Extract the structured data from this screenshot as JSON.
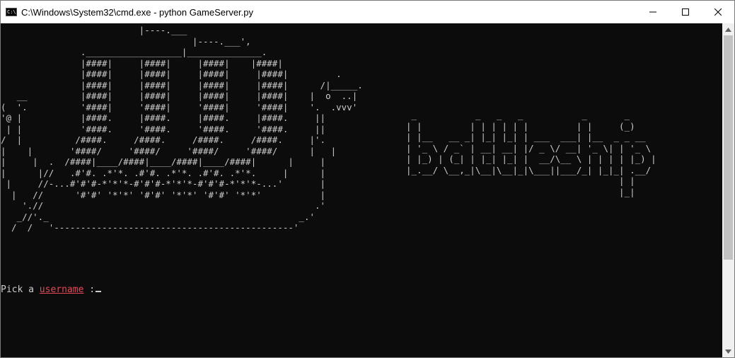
{
  "window": {
    "title": "C:\\Windows\\System32\\cmd.exe - python  GameServer.py",
    "icon": "cmd-icon"
  },
  "controls": {
    "minimize": "minimize-icon",
    "maximize": "maximize-icon",
    "close": "close-icon"
  },
  "terminal": {
    "ship_art": "                          |----.___\n                                    |----.___',\n               .__________________|______________.\n               |####|     |####|     |####|    |####|\n               |####|     |####|     |####|     |####|         .\n               |####|     |####|     |####|     |####|      /|_____.\n   __          |####|     |####|     |####|     |####|    |  o  ..|\n(  '.          '####|     '####|     '####|     '####|    '.  .vvv'\n'@ |           |####.     |####.     |####.     |####.     ||\n | |           '####.     '####.     '####.     '####.     ||\n/  |          /####.     /####.     /####.     /####.     |'.\n|    |       '####/     '####/     '####/     '####/      |   |\n|     |  .  /####|____/####|____/####|____/####|      |     |\n|      |//   .#'#. .*'*. .#'#. .*'*. .#'#. .*'*.     |      |\n |     //-...#'#'#-*'*'*-#'#'#-*'*'*-#'#'#-*'*'*-...'       |\n  |   //      '#'#' '*'*' '#'#' '*'*' '#'#' '*'*'           |\n    './/                                                   .'\n   _//'._                                               _.'\n  /  /   '---------------------------------------------'",
    "logo_art": " _           _   _   _           _       _\n| |         | | | | | |         | |     (_)\n| |__   __ _| |_| |_| | ___  ___| |__  _ _ __\n| '_ \\ / _` | __| __| |/ _ \\/ __| '_ \\| | '_ \\\n| |_) | (_| | |_| |_| |  __/\\__ \\ | | | | |_) |\n|_.__/ \\__,_|\\__|\\__|_|\\___||___/_| |_|_| .__/\n                                        | |\n                                        |_|",
    "prompt_prefix": "Pick a ",
    "prompt_highlight": "username",
    "prompt_suffix": " :",
    "prompt_color": "#e74856"
  },
  "scrollbar": {
    "up": "scroll-up-arrow-icon",
    "down": "scroll-down-arrow-icon"
  }
}
